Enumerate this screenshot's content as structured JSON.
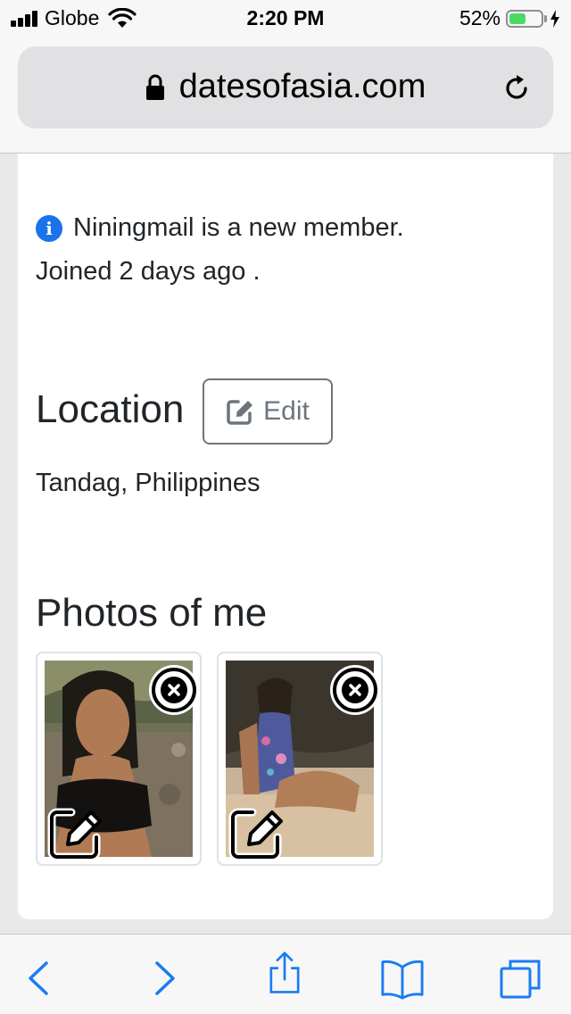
{
  "status_bar": {
    "carrier": "Globe",
    "time": "2:20 PM",
    "battery_percent_text": "52%",
    "battery_level": 0.52
  },
  "browser": {
    "url": "datesofasia.com"
  },
  "profile": {
    "new_member_notice": "Niningmail is a new member.",
    "joined_text": "Joined 2 days ago .",
    "location_heading": "Location",
    "edit_label": "Edit",
    "location_value": "Tandag, Philippines",
    "photos_heading": "Photos of me"
  },
  "colors": {
    "info_icon": "#1a73e8",
    "battery_fill": "#4cd964",
    "toolbar_icon": "#1a7cf2",
    "edit_button_border": "#6c757d"
  },
  "icons": {
    "info": "info-icon",
    "lock": "lock-icon",
    "reload": "reload-icon",
    "edit": "pencil-square-icon",
    "photo_remove": "close-circle-icon",
    "photo_edit": "pencil-square-icon",
    "toolbar": [
      "back-icon",
      "forward-icon",
      "share-icon",
      "bookmarks-icon",
      "tabs-icon"
    ]
  }
}
